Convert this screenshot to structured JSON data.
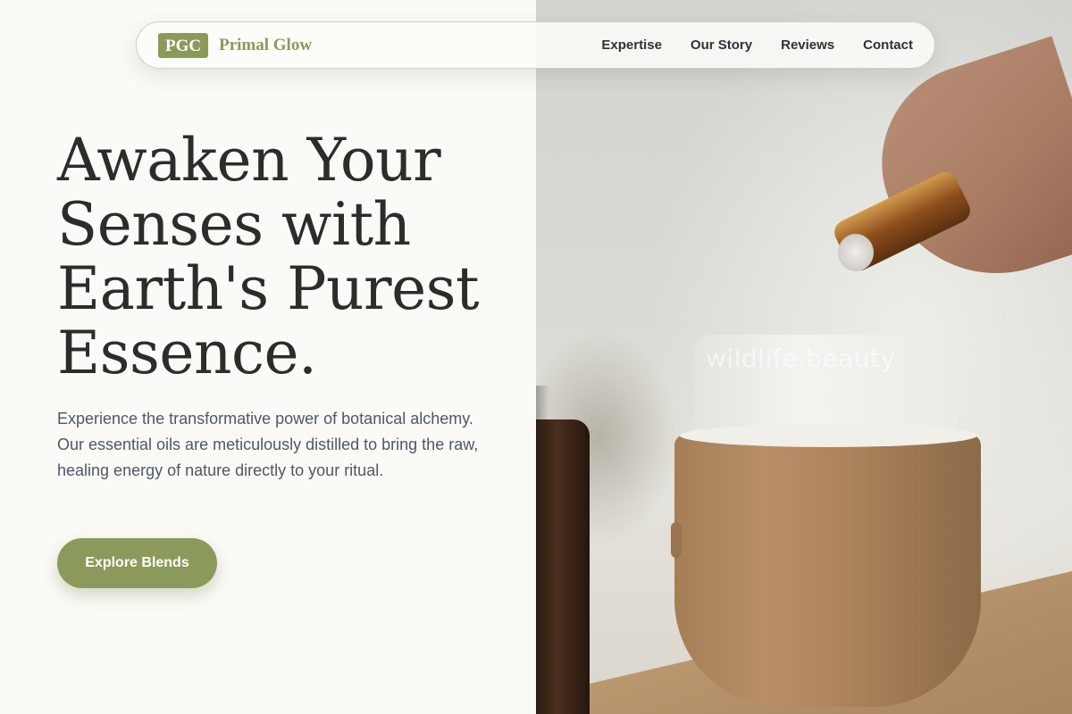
{
  "brand": {
    "logo_text": "PGC",
    "name": "Primal Glow",
    "accent": "#8b9a5b"
  },
  "nav": {
    "links": [
      "Expertise",
      "Our Story",
      "Reviews",
      "Contact"
    ]
  },
  "hero": {
    "headline": "Awaken Your Senses with Earth's Purest Essence.",
    "subtext": "Experience the transformative power of botanical alchemy. Our essential oils are meticulously distilled to bring the raw, healing energy of nature directly to your ritual.",
    "cta_label": "Explore Blends"
  },
  "image": {
    "watermark": "wildlife.beauty",
    "icon": "essential-oil-diffuser-photo"
  }
}
